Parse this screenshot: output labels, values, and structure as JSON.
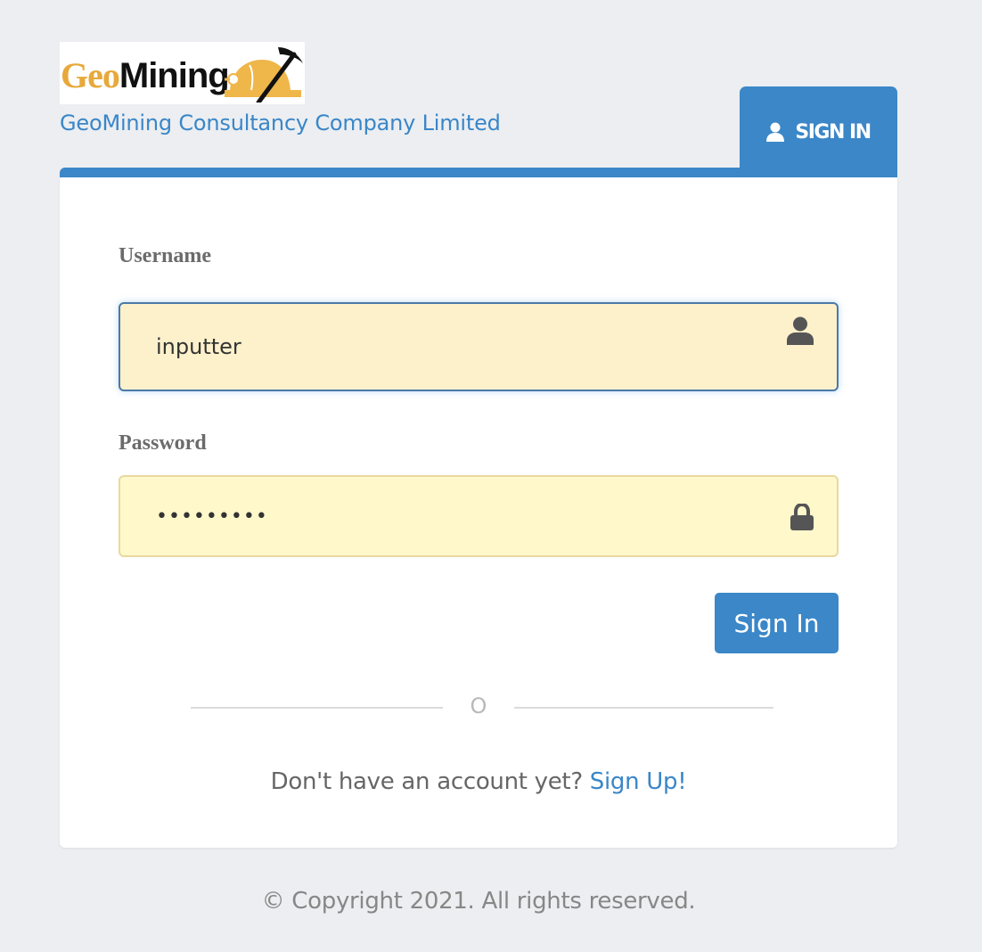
{
  "brand": {
    "logo_geo": "Geo",
    "logo_mining": "Mining",
    "company_name": "GeoMining Consultancy Company Limited"
  },
  "tab": {
    "label": "SIGN IN",
    "icon": "user-icon"
  },
  "form": {
    "username_label": "Username",
    "username_value": "inputter",
    "username_icon": "user-icon",
    "password_label": "Password",
    "password_value": "•••••••••",
    "password_icon": "lock-icon",
    "submit_label": "Sign In"
  },
  "divider_text": "O",
  "signup": {
    "prompt": "Don't have an account yet?",
    "link": "Sign Up!"
  },
  "footer": "© Copyright 2021. All rights reserved.",
  "colors": {
    "accent": "#3b87c8",
    "background": "#eceef1",
    "username_fill": "#fdf1cc",
    "password_fill": "#fef8cb",
    "logo_gold": "#e7a93b"
  }
}
